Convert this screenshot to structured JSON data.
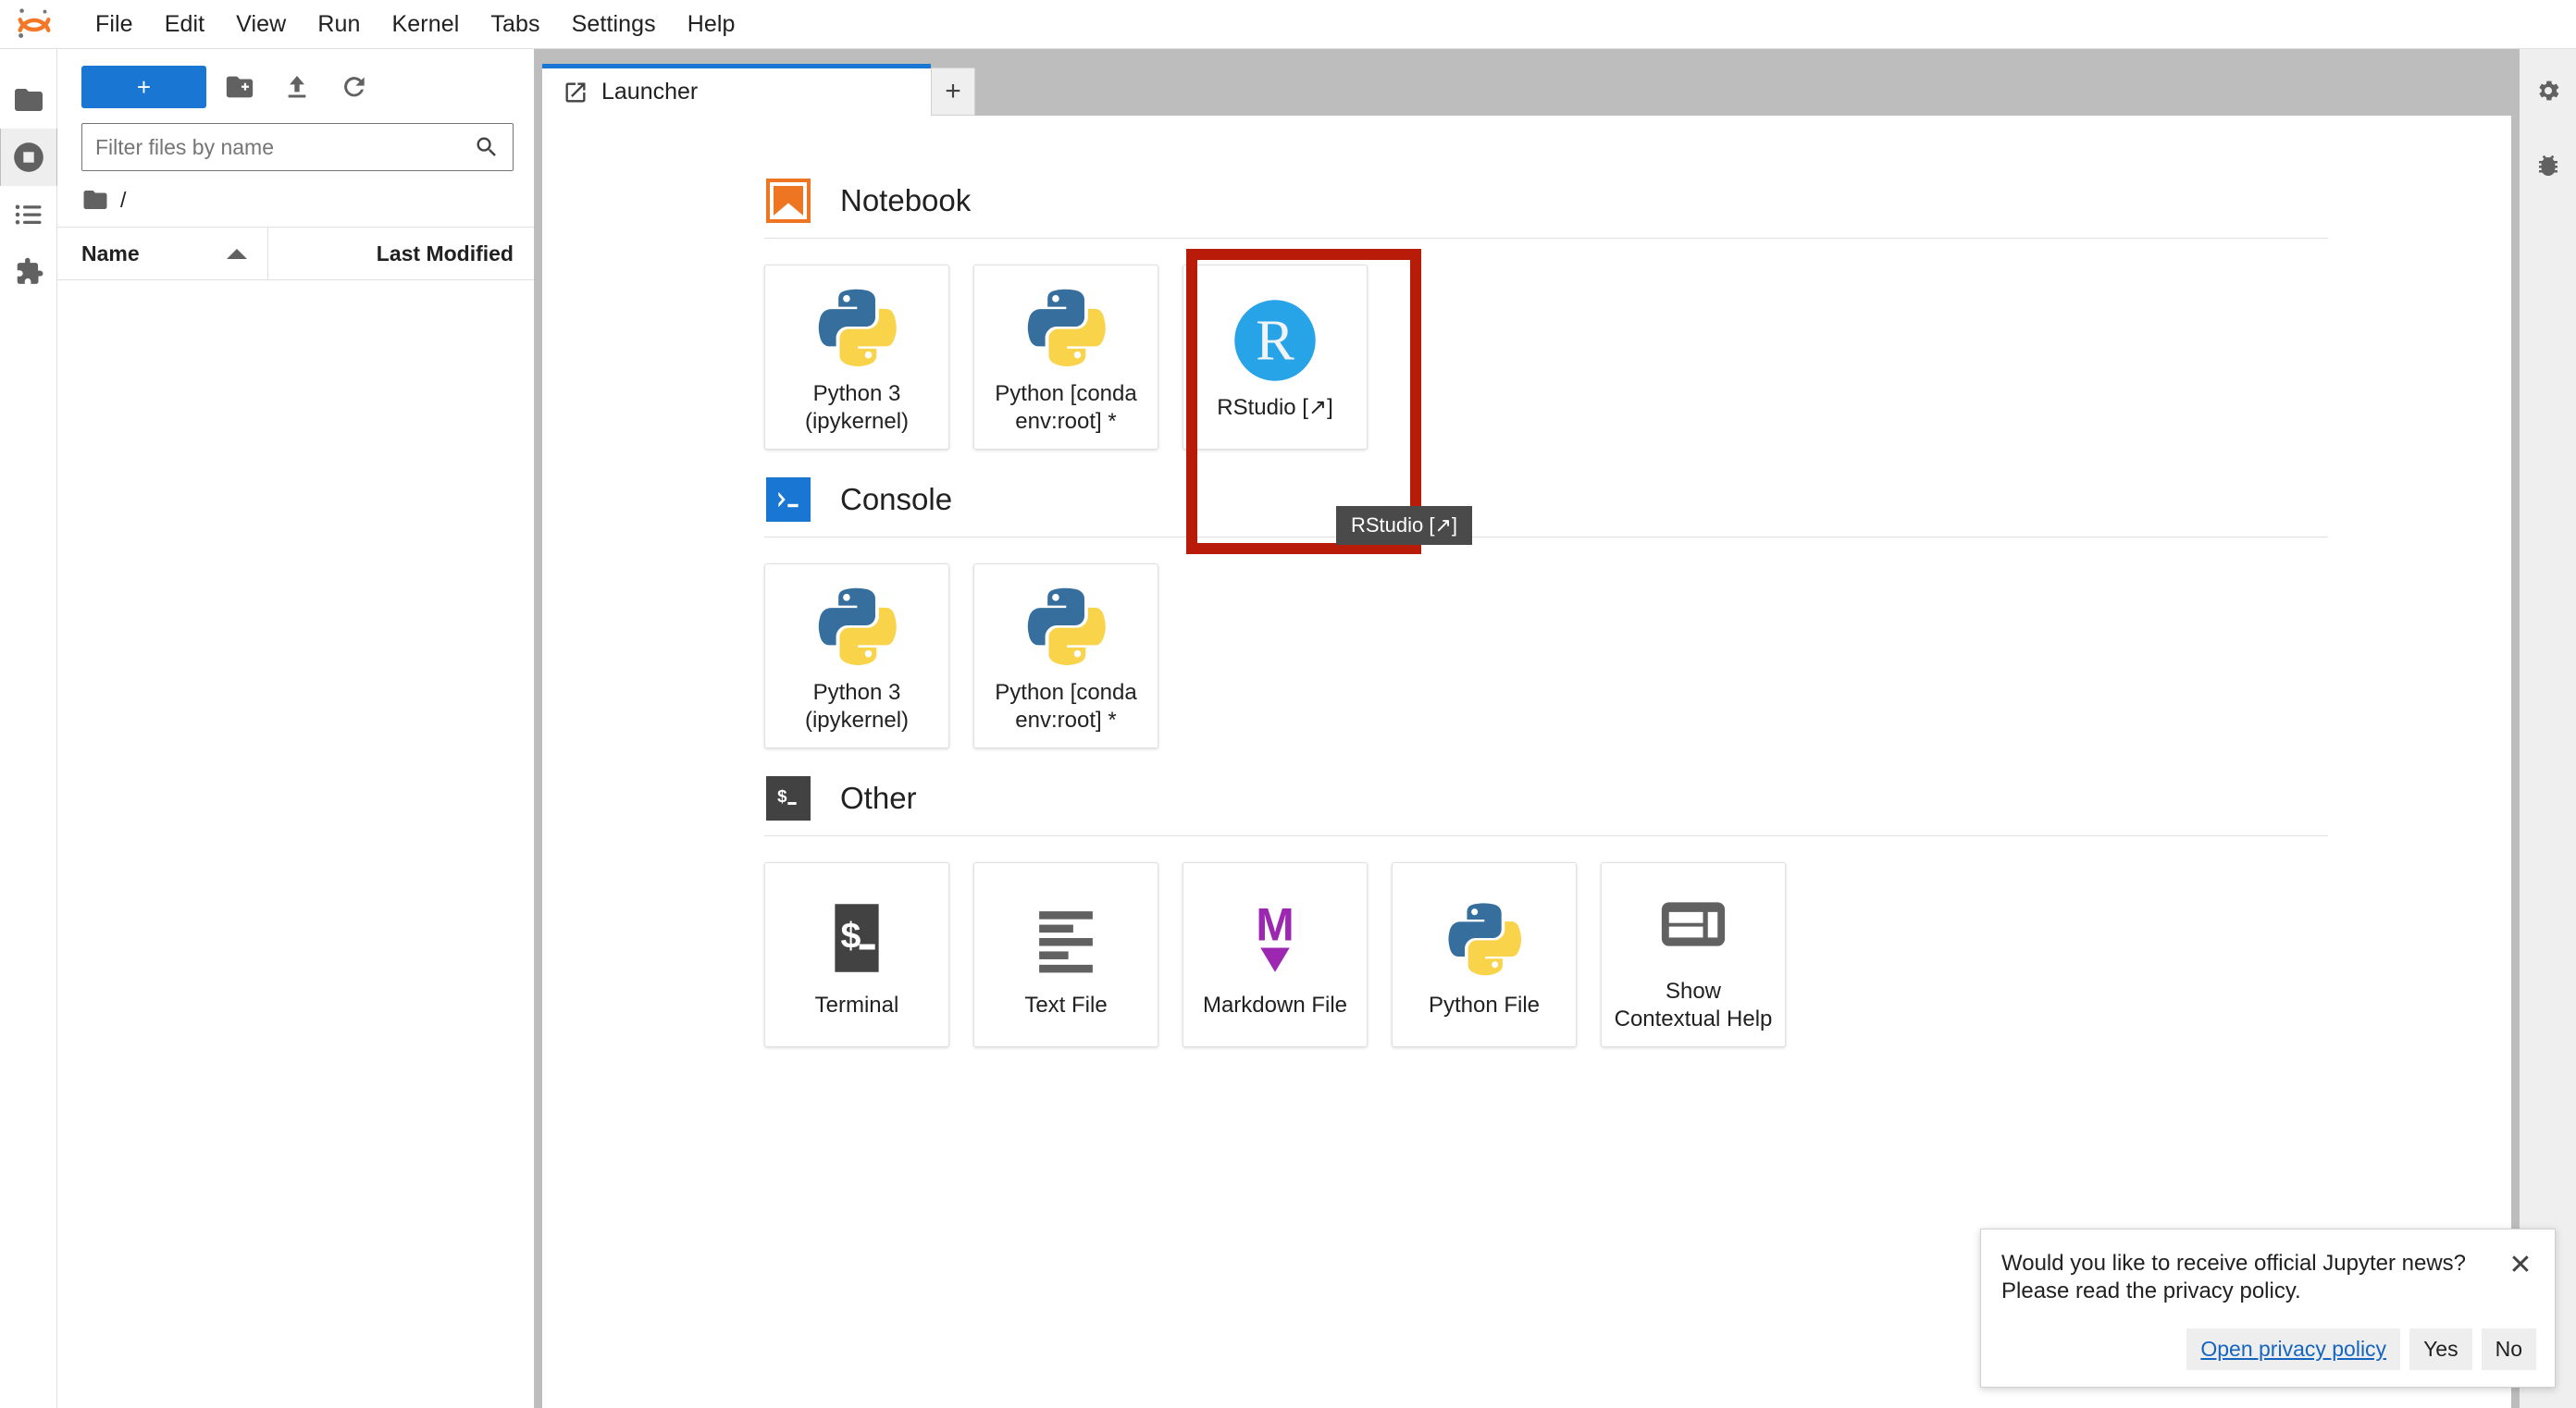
{
  "app": {
    "logo_icon": "jupyter-logo-icon",
    "menu_items": [
      "File",
      "Edit",
      "View",
      "Run",
      "Kernel",
      "Tabs",
      "Settings",
      "Help"
    ]
  },
  "left_activity_bar": {
    "items": [
      {
        "icon": "folder-icon",
        "name": "file-browser",
        "active": false
      },
      {
        "icon": "running-terminals-icon",
        "name": "running-sessions",
        "active": true
      },
      {
        "icon": "command-palette-icon",
        "name": "commands",
        "active": false
      },
      {
        "icon": "puzzle-piece-icon",
        "name": "extension-manager",
        "active": false
      }
    ]
  },
  "right_activity_bar": {
    "items": [
      {
        "icon": "property-inspector-gear-icon",
        "name": "property-inspector"
      },
      {
        "icon": "debugger-bug-icon",
        "name": "debugger"
      }
    ]
  },
  "file_browser": {
    "new_launcher_label": "+",
    "new_folder_icon": "new-folder-icon",
    "upload_icon": "upload-icon",
    "refresh_icon": "refresh-icon",
    "filter": {
      "value": "",
      "placeholder": "Filter files by name"
    },
    "search_icon": "search-icon",
    "breadcrumb": {
      "root_icon": "folder-icon",
      "path": "/"
    },
    "columns": {
      "name": "Name",
      "last_modified": "Last Modified"
    },
    "sort_indicator": "ascending-caret-icon",
    "rows": []
  },
  "main": {
    "tabs": [
      {
        "label": "Launcher",
        "icon": "launcher-icon",
        "active": true
      }
    ],
    "add_tab_label": "+"
  },
  "launcher": {
    "sections": [
      {
        "id": "notebook",
        "title": "Notebook",
        "icon": "notebook-bookmark-icon",
        "cards": [
          {
            "label": "Python 3\n(ipykernel)",
            "line1": "Python 3",
            "line2": "(ipykernel)",
            "icon": "python-logo-icon"
          },
          {
            "label": "Python [conda env:root] *",
            "line1": "Python [conda",
            "line2": "env:root] *",
            "icon": "python-logo-icon"
          },
          {
            "label": "RStudio [↗]",
            "line1": "RStudio [↗]",
            "line2": "",
            "icon": "rstudio-r-icon",
            "highlighted": true
          }
        ]
      },
      {
        "id": "console",
        "title": "Console",
        "icon": "console-prompt-icon",
        "cards": [
          {
            "label": "Python 3\n(ipykernel)",
            "line1": "Python 3",
            "line2": "(ipykernel)",
            "icon": "python-logo-icon"
          },
          {
            "label": "Python [conda env:root] *",
            "line1": "Python [conda",
            "line2": "env:root] *",
            "icon": "python-logo-icon"
          }
        ]
      },
      {
        "id": "other",
        "title": "Other",
        "icon": "terminal-dollar-icon",
        "cards": [
          {
            "label": "Terminal",
            "line1": "Terminal",
            "line2": "",
            "icon": "terminal-dollar-icon"
          },
          {
            "label": "Text File",
            "line1": "Text File",
            "line2": "",
            "icon": "text-file-icon"
          },
          {
            "label": "Markdown File",
            "line1": "Markdown File",
            "line2": "",
            "icon": "markdown-icon"
          },
          {
            "label": "Python File",
            "line1": "Python File",
            "line2": "",
            "icon": "python-logo-icon"
          },
          {
            "label": "Show Contextual Help",
            "line1": "Show",
            "line2": "Contextual Help",
            "icon": "contextual-help-icon"
          }
        ]
      }
    ],
    "tooltip": {
      "text": "RStudio [↗]",
      "visible": true
    }
  },
  "notification": {
    "line1": "Would you like to receive official Jupyter news?",
    "line2": "Please read the privacy policy.",
    "close_icon": "close-icon",
    "buttons": [
      {
        "label": "Open privacy policy",
        "style": "link"
      },
      {
        "label": "Yes",
        "style": "default"
      },
      {
        "label": "No",
        "style": "default"
      }
    ]
  },
  "colors": {
    "accent_blue": "#1976d2",
    "notebook_orange": "#ee7623",
    "highlight_red": "#b81c08",
    "rstudio_blue": "#27a3e8",
    "markdown_purple": "#9c27b0",
    "python_blue": "#366f9d",
    "python_yellow": "#f9d34a",
    "tooltip_bg": "#4a4a4a"
  }
}
